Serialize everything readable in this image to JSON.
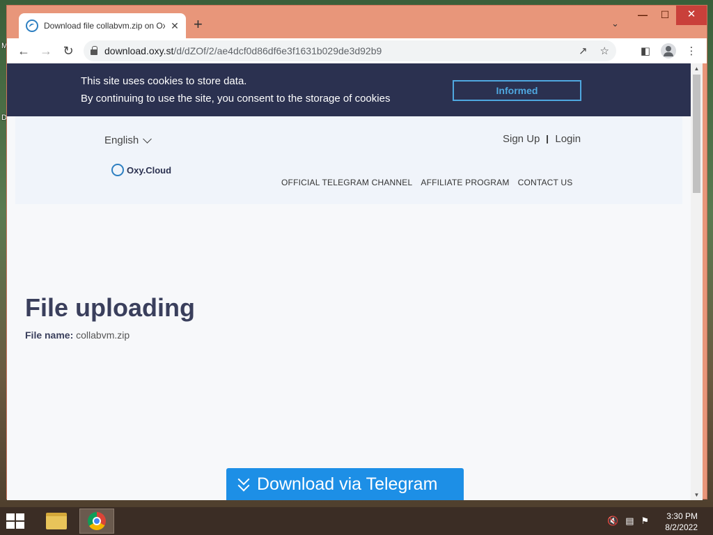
{
  "desktop": {
    "glyph_top": "M",
    "glyph_mid": "D"
  },
  "browser": {
    "tab_title": "Download file collabvm.zip on Oxy.Cloud",
    "new_tab": "+",
    "tab_close": "✕",
    "window_controls": {
      "minimize": "—",
      "maximize": "☐",
      "close": "✕"
    },
    "url_host": "download.oxy.st",
    "url_path": "/d/dZOf/2/ae4dcf0d86df6e3f1631b029de3d92b9",
    "icons": [
      "back-icon",
      "forward-icon",
      "reload-icon",
      "lock-icon",
      "share-icon",
      "star-icon",
      "side-panel-icon",
      "profile-icon",
      "menu-icon"
    ]
  },
  "cookie": {
    "line1": "This site uses cookies to store data.",
    "line2": "By continuing to use the site, you consent to the storage of cookies",
    "button": "Informed"
  },
  "header": {
    "language": "English",
    "sign_up": "Sign Up",
    "login": "Login",
    "logo_text": "Oxy.Cloud",
    "nav": [
      "OFFICIAL TELEGRAM CHANNEL",
      "AFFILIATE PROGRAM",
      "CONTACT US"
    ]
  },
  "main": {
    "title": "File uploading",
    "file_label": "File name:",
    "file_name": "collabvm.zip",
    "download_button": "Download via Telegram"
  },
  "taskbar": {
    "time": "3:30 PM",
    "date": "8/2/2022"
  },
  "colors": {
    "cookie_bar": "#2b3150",
    "accent": "#1d8fe6",
    "window_frame": "#e8967a"
  }
}
